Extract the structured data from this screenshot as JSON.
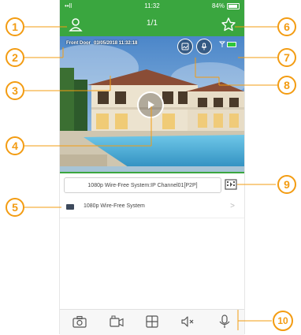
{
  "statusbar": {
    "signal": "••ll",
    "time": "11:32",
    "battery": "84%"
  },
  "header": {
    "title": "1/1",
    "left_icon": "user-icon",
    "right_icon": "star-icon"
  },
  "video": {
    "camera_name": "Front Door",
    "timestamp": "03/05/2018 11:32:18",
    "icons": [
      "snapshot-icon",
      "mic-icon",
      "signal-icon",
      "battery-icon",
      "play-icon"
    ]
  },
  "channel": {
    "label": "1080p Wire-Free System:IP Channel01[P2P]"
  },
  "device": {
    "name": "1080p Wire-Free System",
    "chevron": ">"
  },
  "toolbar": {
    "items": [
      "camera-icon",
      "record-icon",
      "grid-icon",
      "mute-icon",
      "mic-icon"
    ]
  },
  "callouts": [
    "1",
    "2",
    "3",
    "4",
    "5",
    "6",
    "7",
    "8",
    "9",
    "10"
  ],
  "colors": {
    "brand_green": "#3aa63f",
    "callout_orange": "#f39c12"
  }
}
